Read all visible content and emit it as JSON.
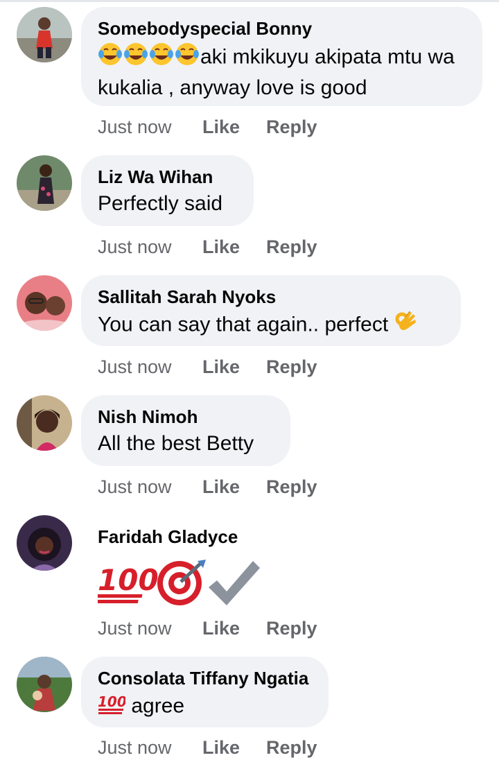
{
  "comments": [
    {
      "name": "Somebodyspecial Bonny",
      "text": "aki mkikuyu akipata mtu wa kukalia , anyway love is good",
      "time": "Just now",
      "like": "Like",
      "reply": "Reply"
    },
    {
      "name": "Liz Wa Wihan",
      "text": "Perfectly said",
      "time": "Just now",
      "like": "Like",
      "reply": "Reply"
    },
    {
      "name": "Sallitah Sarah Nyoks",
      "text": "You can say that again.. perfect",
      "time": "Just now",
      "like": "Like",
      "reply": "Reply"
    },
    {
      "name": "Nish Nimoh",
      "text": "All the best Betty",
      "time": "Just now",
      "like": "Like",
      "reply": "Reply"
    },
    {
      "name": "Faridah Gladyce",
      "text": "",
      "time": "Just now",
      "like": "Like",
      "reply": "Reply"
    },
    {
      "name": "Consolata Tiffany Ngatia",
      "text": "agree",
      "time": "Just now",
      "like": "Like",
      "reply": "Reply"
    }
  ],
  "icons": {
    "laughing": "face-with-tears-of-joy-icon",
    "ok_hand": "ok-hand-icon",
    "hundred": "hundred-points-icon",
    "target": "direct-hit-icon",
    "check": "check-mark-icon"
  },
  "colors": {
    "bubble": "#f0f2f5",
    "meta": "#65676b",
    "text": "#050505"
  }
}
